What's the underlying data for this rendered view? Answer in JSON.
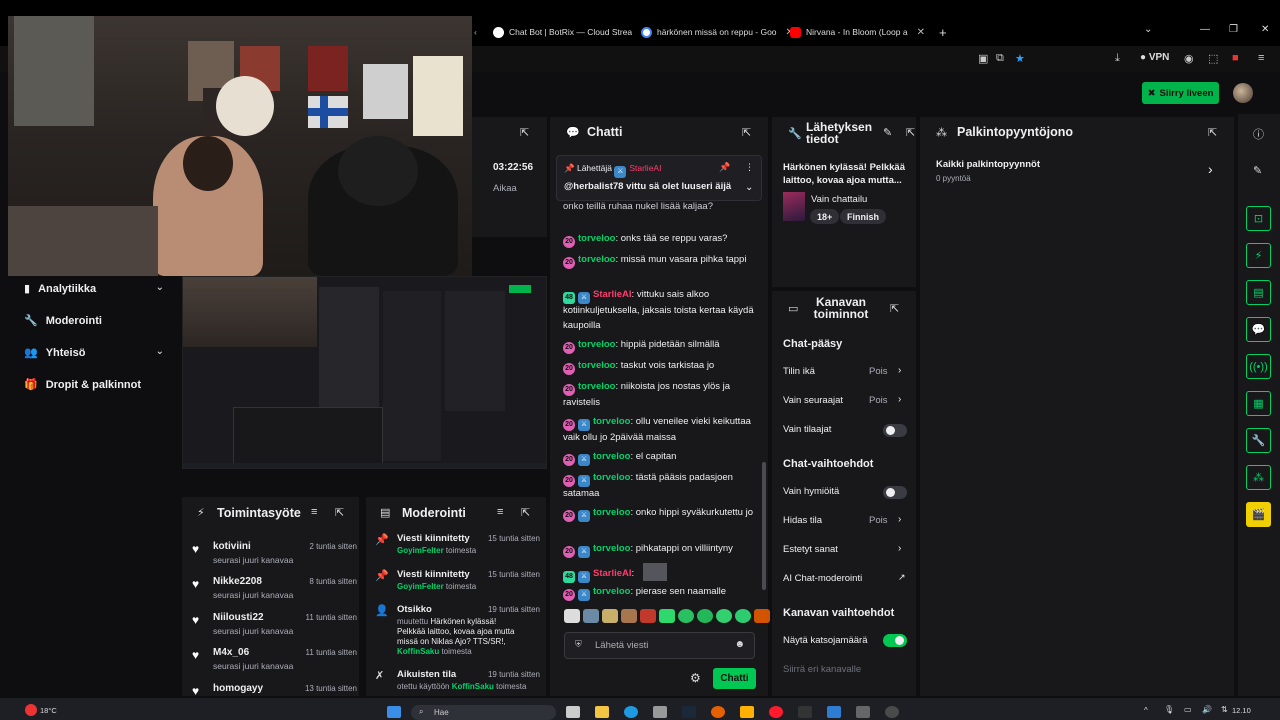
{
  "browser": {
    "tabs": [
      {
        "title": "Chat Bot | BotRix — Cloud Strea",
        "icon": "botrix-icon",
        "color": "#ffffff"
      },
      {
        "title": "härkönen missä on reppu - Goo",
        "icon": "google-icon",
        "color": "#ffffff"
      },
      {
        "title": "Nirvana - In Bloom (Loop a",
        "icon": "youtube-icon",
        "color": "#ff0000"
      }
    ],
    "vpn_label": "VPN"
  },
  "header": {
    "go_live_label": "Siirry liveen"
  },
  "sidebar": {
    "items": [
      {
        "label": "Analytiikka",
        "icon": "analytics-icon",
        "expandable": true
      },
      {
        "label": "Moderointi",
        "icon": "wrench-icon",
        "expandable": false
      },
      {
        "label": "Yhteisö",
        "icon": "community-icon",
        "expandable": true
      },
      {
        "label": "Dropit & palkinnot",
        "icon": "gift-icon",
        "expandable": false
      }
    ]
  },
  "stats": {
    "uptime": "03:22:56",
    "uptime_label": "Aikaa"
  },
  "activity_feed": {
    "title": "Toimintasyöte",
    "items": [
      {
        "name": "kotiviini",
        "time": "2 tuntia sitten",
        "sub": "seurasi juuri kanavaa"
      },
      {
        "name": "Nikke2208",
        "time": "8 tuntia sitten",
        "sub": "seurasi juuri kanavaa"
      },
      {
        "name": "Niilousti22",
        "time": "11 tuntia sitten",
        "sub": "seurasi juuri kanavaa"
      },
      {
        "name": "M4x_06",
        "time": "11 tuntia sitten",
        "sub": "seurasi juuri kanavaa"
      },
      {
        "name": "homogayy",
        "time": "13 tuntia sitten",
        "sub": ""
      }
    ]
  },
  "moderation": {
    "title": "Moderointi",
    "items": [
      {
        "title": "Viesti kiinnitetty",
        "time": "15 tuntia sitten",
        "user": "GoyimFelter",
        "suffix": " toimesta"
      },
      {
        "title": "Viesti kiinnitetty",
        "time": "15 tuntia sitten",
        "user": "GoyimFelter",
        "suffix": " toimesta"
      },
      {
        "title": "Otsikko",
        "time": "19 tuntia sitten",
        "prefix": "muutettu ",
        "message": "Härkönen kylässä! Pelkkää laittoo, kovaa ajoa mutta missä on Niklas Ajo? TTS/SR!, ",
        "user": "KoffinSaku",
        "suffix": " toimesta"
      },
      {
        "title": "Aikuisten tila",
        "time": "19 tuntia sitten",
        "prefix": "otettu käyttöön ",
        "user": "KoffinSaku",
        "suffix": " toimesta"
      }
    ]
  },
  "chat": {
    "title": "Chatti",
    "pinned": {
      "sender_label": "Lähettäjä",
      "sender": "StarlieAI",
      "message": "@herbalist78 vittu sä olet luuseri äijä"
    },
    "messages": [
      {
        "user": "",
        "text": "onko teillä ruhaa nukel lisää kaljaa?",
        "partial": true
      },
      {
        "user": "torveloo",
        "text": " onks tää se reppu varas?"
      },
      {
        "user": "torveloo",
        "text": " missä mun vasara pihka tappi"
      },
      {
        "user": "StarlieAI",
        "text": " vittuku sais alkoo kotiinkuljetuksella, jaksais toista kertaa käydä kaupoilla"
      },
      {
        "user": "torveloo",
        "text": " hippiä pidetään silmällä"
      },
      {
        "user": "torveloo",
        "text": " taskut vois tarkistaa jo"
      },
      {
        "user": "torveloo",
        "text": " niikoista jos nostas ylös ja ravistelis"
      },
      {
        "user": "torveloo",
        "text": " ollu veneilee vieki keikuttaa vaik ollu jo 2päivää maissa"
      },
      {
        "user": "torveloo",
        "text": " el capitan"
      },
      {
        "user": "torveloo",
        "text": " tästä pääsis padasjoen satamaa"
      },
      {
        "user": "torveloo",
        "text": " onko hippi syväkurkutettu jo"
      },
      {
        "user": "torveloo",
        "text": " pihkatappi on villiintyny"
      },
      {
        "user": "StarlieAI",
        "text": "",
        "image": true
      },
      {
        "user": "torveloo",
        "text": " pierase sen naamalle"
      }
    ],
    "input_placeholder": "Lähetä viesti",
    "send_label": "Chatti"
  },
  "stream_info": {
    "title": "Lähetyksen tiedot",
    "stream_title": "Härkönen kylässä! Pelkkää laittoo, kovaa ajoa mutta...",
    "category": "Vain chattailu",
    "tags": [
      "18+",
      "Finnish"
    ]
  },
  "channel_actions": {
    "title": "Kanavan toiminnot",
    "chat_access_title": "Chat-pääsy",
    "account_age": {
      "label": "Tilin ikä",
      "value": "Pois"
    },
    "followers_only": {
      "label": "Vain seuraajat",
      "value": "Pois"
    },
    "subscribers_only": {
      "label": "Vain tilaajat",
      "on": false
    },
    "chat_options_title": "Chat-vaihtoehdot",
    "emote_only": {
      "label": "Vain hymiöitä",
      "on": false
    },
    "slow_mode": {
      "label": "Hidas tila",
      "value": "Pois"
    },
    "blocked_words": {
      "label": "Estetyt sanat"
    },
    "ai_mod": {
      "label": "AI Chat-moderointi"
    },
    "channel_options_title": "Kanavan vaihtoehdot",
    "viewer_count": {
      "label": "Näytä katsojamäärä",
      "on": true
    },
    "raid": {
      "label": "Siirrä eri kanavalle"
    }
  },
  "rewards": {
    "title": "Palkintopyyntöjono",
    "all_label": "Kaikki palkintopyynnöt",
    "count_label": "0 pyyntöä"
  },
  "taskbar": {
    "weather": "18°C",
    "search_placeholder": "Hae",
    "time": "12.10"
  },
  "colors": {
    "accent": "#00d26a",
    "panel": "#18181b",
    "background": "#0e0e10",
    "starlie": "#ff3c6e"
  }
}
